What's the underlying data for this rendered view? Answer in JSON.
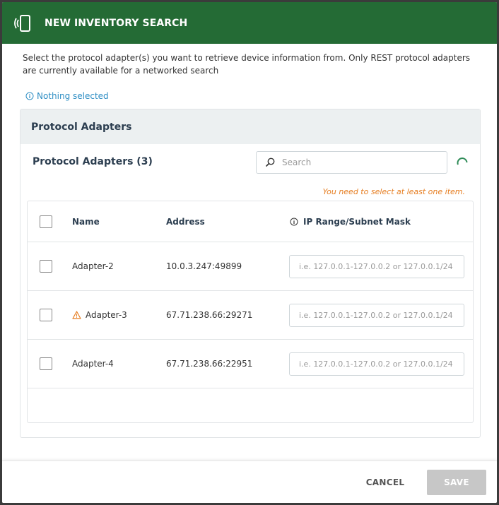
{
  "dialog": {
    "title": "NEW INVENTORY SEARCH",
    "icon": "device-signal-icon",
    "description": "Select the protocol adapter(s) you want to retrieve device information from. Only REST protocol adapters are currently available for a networked search",
    "selection_status": "Nothing selected"
  },
  "panel": {
    "header": "Protocol Adapters",
    "subtitle": "Protocol Adapters (3)",
    "search_placeholder": "Search",
    "validation_message": "You need to select at least one item."
  },
  "table": {
    "columns": {
      "name": "Name",
      "address": "Address",
      "ip_range": "IP Range/Subnet Mask"
    },
    "ip_placeholder": "i.e. 127.0.0.1-127.0.0.2 or 127.0.0.1/24",
    "rows": [
      {
        "name": "Adapter-2",
        "address": "10.0.3.247:49899",
        "warning": false
      },
      {
        "name": "Adapter-3",
        "address": "67.71.238.66:29271",
        "warning": true
      },
      {
        "name": "Adapter-4",
        "address": "67.71.238.66:22951",
        "warning": false
      }
    ]
  },
  "footer": {
    "cancel_label": "CANCEL",
    "save_label": "SAVE"
  },
  "colors": {
    "header_bg": "#246b35",
    "link": "#2e8ec4",
    "warning": "#e67e22",
    "save_disabled": "#c7c7c7"
  }
}
